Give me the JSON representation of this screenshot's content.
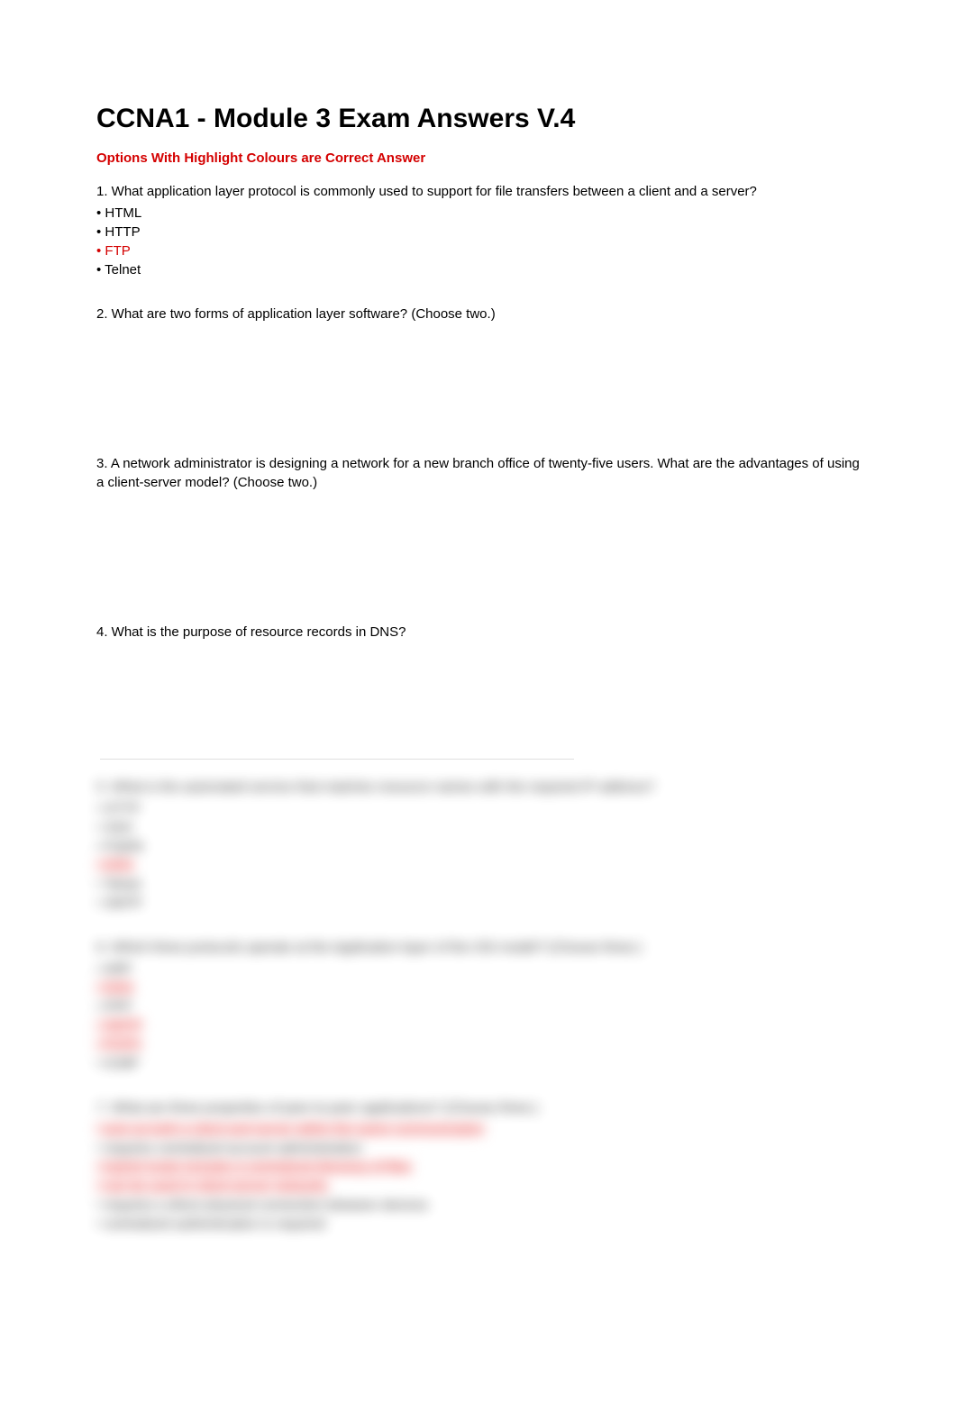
{
  "title": "CCNA1 - Module 3 Exam Answers V.4",
  "subtitle": "Options With Highlight Colours are Correct Answer",
  "q1": {
    "text": "1. What application layer protocol is commonly used to support for file transfers between a client and a server?",
    "opts": [
      "• HTML",
      "• HTTP",
      "• FTP",
      "• Telnet"
    ]
  },
  "q2": {
    "text": "2. What are two forms of application layer software? (Choose two.)"
  },
  "q3": {
    "text": "3. A network administrator is designing a network for a new branch office of twenty-five users. What are the advantages of using a client-server model? (Choose two.)"
  },
  "q4": {
    "text": "4. What is the purpose of resource records in DNS?"
  },
  "blur5": {
    "text": "5. What is the automated service that matches resource names with the required IP address?",
    "opts": [
      "• HTTP",
      "• SSH",
      "• FQDN",
      "• DNS",
      "• Telnet",
      "• SMTP"
    ]
  },
  "blur6": {
    "text": "6. Which three protocols operate at the Application layer of the OSI model? (Choose three.)",
    "opts": [
      "• ARP",
      "• DNS",
      "• PPP",
      "• SMTP",
      "• POP3",
      "• ICMP"
    ]
  },
  "blur7": {
    "text": "7. What are three properties of peer-to-peer applications? (Choose three.)",
    "opts": [
      "• acts as both a client and server within the same communication",
      "• requires centralized account administration",
      "• hybrid mode includes a centralized directory of files",
      "• can be used in client-server networks",
      "• requires a direct physical connection between devices",
      "• centralized authentication is required"
    ]
  }
}
